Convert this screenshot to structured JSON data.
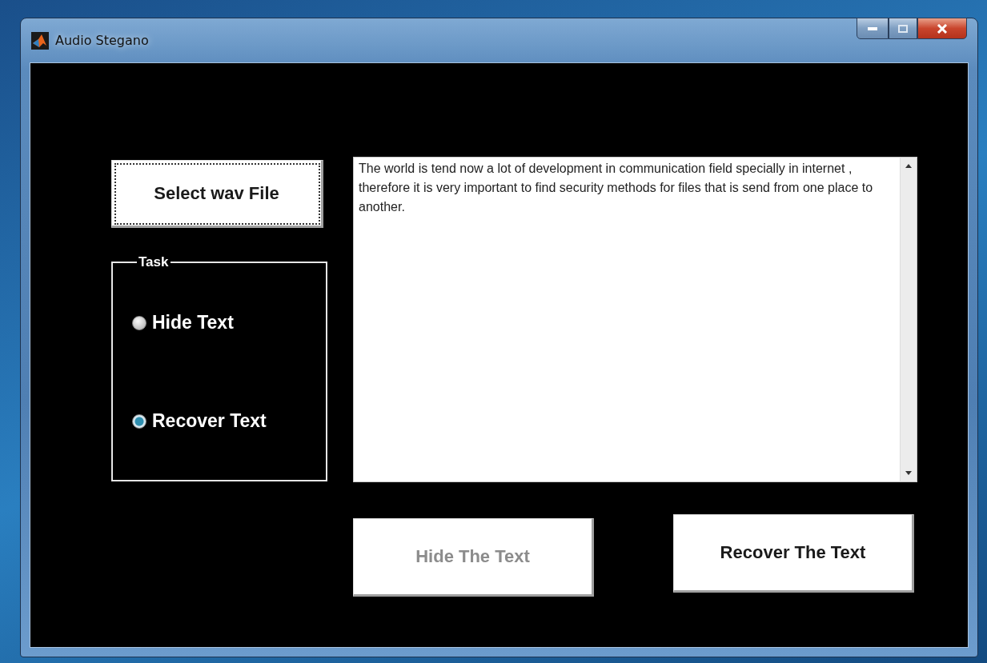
{
  "window": {
    "title": "Audio Stegano"
  },
  "select_button": {
    "label": "Select wav File",
    "focused": true
  },
  "task": {
    "title": "Task",
    "options": [
      {
        "label": "Hide Text",
        "selected": false
      },
      {
        "label": "Recover Text",
        "selected": true
      }
    ]
  },
  "text_area": {
    "value": "The world is tend now a lot of development in communication field specially in internet , therefore it is very important to find security methods for files that is send from one place to another."
  },
  "buttons": [
    {
      "label": "Hide The Text",
      "disabled": true
    },
    {
      "label": "Recover The Text",
      "disabled": false
    }
  ]
}
